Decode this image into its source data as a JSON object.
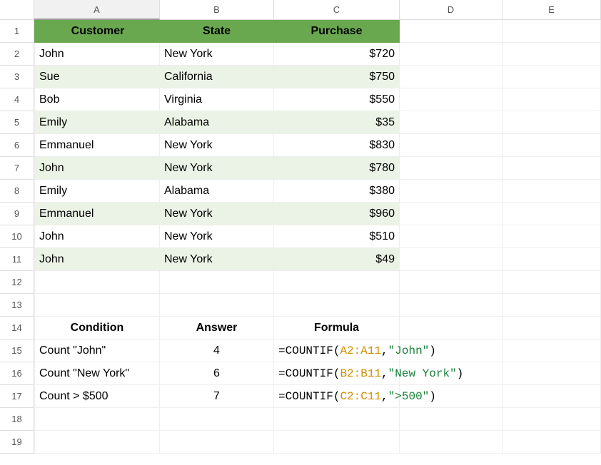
{
  "columns": [
    "A",
    "B",
    "C",
    "D",
    "E"
  ],
  "rows": [
    "1",
    "2",
    "3",
    "4",
    "5",
    "6",
    "7",
    "8",
    "9",
    "10",
    "11",
    "12",
    "13",
    "14",
    "15",
    "16",
    "17",
    "18",
    "19"
  ],
  "active_column": "A",
  "table": {
    "headers": {
      "customer": "Customer",
      "state": "State",
      "purchase": "Purchase"
    },
    "rows": [
      {
        "customer": "John",
        "state": "New York",
        "purchase": "$720"
      },
      {
        "customer": "Sue",
        "state": "California",
        "purchase": "$750"
      },
      {
        "customer": "Bob",
        "state": "Virginia",
        "purchase": "$550"
      },
      {
        "customer": "Emily",
        "state": "Alabama",
        "purchase": "$35"
      },
      {
        "customer": "Emmanuel",
        "state": "New York",
        "purchase": "$830"
      },
      {
        "customer": "John",
        "state": "New York",
        "purchase": "$780"
      },
      {
        "customer": "Emily",
        "state": "Alabama",
        "purchase": "$380"
      },
      {
        "customer": "Emmanuel",
        "state": "New York",
        "purchase": "$960"
      },
      {
        "customer": "John",
        "state": "New York",
        "purchase": "$510"
      },
      {
        "customer": "John",
        "state": "New York",
        "purchase": "$49"
      }
    ]
  },
  "summary": {
    "headers": {
      "condition": "Condition",
      "answer": "Answer",
      "formula": "Formula"
    },
    "rows": [
      {
        "condition": "Count \"John\"",
        "answer": "4",
        "formula_eq": "=",
        "formula_fn": "COUNTIF",
        "formula_open": "(",
        "formula_range": "A2:A11",
        "formula_comma": ",",
        "formula_str": "\"John\"",
        "formula_close": ")"
      },
      {
        "condition": "Count \"New York\"",
        "answer": "6",
        "formula_eq": "=",
        "formula_fn": "COUNTIF",
        "formula_open": "(",
        "formula_range": "B2:B11",
        "formula_comma": ",",
        "formula_str": "\"New York\"",
        "formula_close": ")"
      },
      {
        "condition": "Count > $500",
        "answer": "7",
        "formula_eq": "=",
        "formula_fn": "COUNTIF",
        "formula_open": "(",
        "formula_range": "C2:C11",
        "formula_comma": ",",
        "formula_str": "\">500\"",
        "formula_close": ")"
      }
    ]
  },
  "chart_data": {
    "type": "table",
    "title": "",
    "columns": [
      "Customer",
      "State",
      "Purchase"
    ],
    "rows": [
      [
        "John",
        "New York",
        720
      ],
      [
        "Sue",
        "California",
        750
      ],
      [
        "Bob",
        "Virginia",
        550
      ],
      [
        "Emily",
        "Alabama",
        35
      ],
      [
        "Emmanuel",
        "New York",
        830
      ],
      [
        "John",
        "New York",
        780
      ],
      [
        "Emily",
        "Alabama",
        380
      ],
      [
        "Emmanuel",
        "New York",
        960
      ],
      [
        "John",
        "New York",
        510
      ],
      [
        "John",
        "New York",
        49
      ]
    ],
    "summary": [
      {
        "condition": "Count \"John\"",
        "answer": 4,
        "formula": "=COUNTIF(A2:A11,\"John\")"
      },
      {
        "condition": "Count \"New York\"",
        "answer": 6,
        "formula": "=COUNTIF(B2:B11,\"New York\")"
      },
      {
        "condition": "Count > $500",
        "answer": 7,
        "formula": "=COUNTIF(C2:C11,\">500\")"
      }
    ]
  }
}
